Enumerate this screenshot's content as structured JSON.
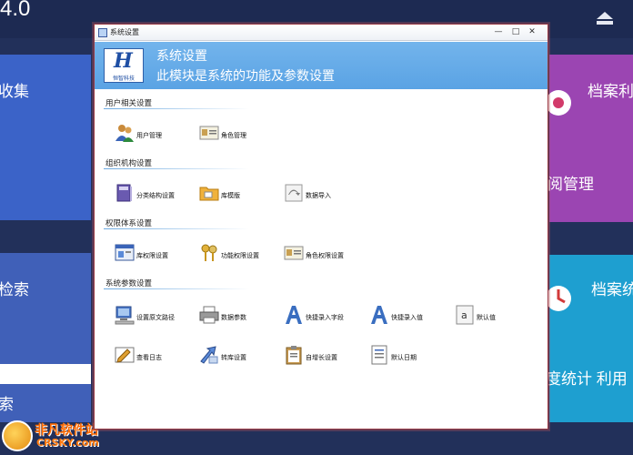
{
  "background": {
    "title": "4.0",
    "tiles": {
      "left_top": "收集",
      "left_bottom": "检索",
      "left_bottom_lower": "索",
      "right_top": "档案利",
      "right_top_lower": "阅管理",
      "right_bottom": "档案统",
      "right_bottom_lower": "度统计  利用"
    }
  },
  "watermark": {
    "title": "非凡软件站",
    "subtitle": "CRSKY.com"
  },
  "dialog": {
    "title": "系统设置",
    "controls": {
      "minimize": "—",
      "maximize": "□",
      "close": "✕"
    },
    "banner": {
      "logo_text": "恒智科技",
      "line1": "系统设置",
      "line2": "此模块是系统的功能及参数设置"
    },
    "sections": [
      {
        "title": "用户相关设置",
        "items": [
          {
            "label": "用户管理",
            "icon": "users-icon"
          },
          {
            "label": "角色管理",
            "icon": "id-card-icon"
          }
        ]
      },
      {
        "title": "组织机构设置",
        "items": [
          {
            "label": "分类结构设置",
            "icon": "books-icon"
          },
          {
            "label": "库模版",
            "icon": "folder-icon"
          },
          {
            "label": "数据导入",
            "icon": "import-icon"
          }
        ]
      },
      {
        "title": "权限体系设置",
        "items": [
          {
            "label": "库权限设置",
            "icon": "window-permission-icon"
          },
          {
            "label": "功能权限设置",
            "icon": "keys-icon"
          },
          {
            "label": "角色权限设置",
            "icon": "id-card-icon"
          }
        ]
      },
      {
        "title": "系统参数设置",
        "items": [
          {
            "label": "设置原文路径",
            "icon": "computer-icon"
          },
          {
            "label": "数据参数",
            "icon": "printer-icon"
          },
          {
            "label": "快捷录入字段",
            "icon": "letter-a-icon"
          },
          {
            "label": "快捷录入值",
            "icon": "letter-a-icon"
          },
          {
            "label": "默认值",
            "icon": "text-a-icon"
          },
          {
            "label": "查看日志",
            "icon": "log-icon"
          },
          {
            "label": "转库设置",
            "icon": "transfer-icon"
          },
          {
            "label": "自增长设置",
            "icon": "clipboard-icon"
          },
          {
            "label": "默认日期",
            "icon": "document-icon"
          }
        ]
      }
    ]
  }
}
